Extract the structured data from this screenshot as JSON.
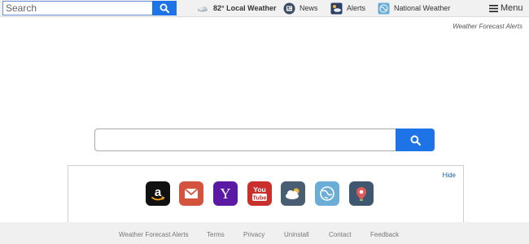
{
  "topbar": {
    "search_placeholder": "Search",
    "nav": {
      "weather_label": "82° Local Weather",
      "news_label": "News",
      "alerts_label": "Alerts",
      "national_label": "National Weather",
      "menu_label": "Menu"
    }
  },
  "brand_tagline": "Weather Forecast Alerts",
  "main_search": {
    "value": ""
  },
  "quicklinks": {
    "hide_label": "Hide",
    "tiles": [
      {
        "name": "amazon",
        "icon": "amazon-icon",
        "color": "#111111"
      },
      {
        "name": "gmail",
        "icon": "gmail-icon",
        "color": "#d3533f"
      },
      {
        "name": "yahoo",
        "icon": "yahoo-icon",
        "color": "#5b1aa3",
        "glyph": "Y"
      },
      {
        "name": "youtube",
        "icon": "youtube-icon",
        "color": "#c9302c",
        "glyph_top": "You",
        "glyph_bottom": "Tube"
      },
      {
        "name": "weather",
        "icon": "cloud-icon",
        "color": "#4a5e73"
      },
      {
        "name": "maps",
        "icon": "globe-icon",
        "color": "#6aaed8"
      },
      {
        "name": "pins",
        "icon": "map-pin-icon",
        "color": "#3f5870"
      }
    ]
  },
  "footer": {
    "links": [
      "Weather Forecast Alerts",
      "Terms",
      "Privacy",
      "Uninstall",
      "Contact",
      "Feedback"
    ]
  },
  "colors": {
    "accent": "#1e74e6",
    "topbar_bg": "#f1f1f1",
    "footer_bg": "#f0f0f0"
  }
}
